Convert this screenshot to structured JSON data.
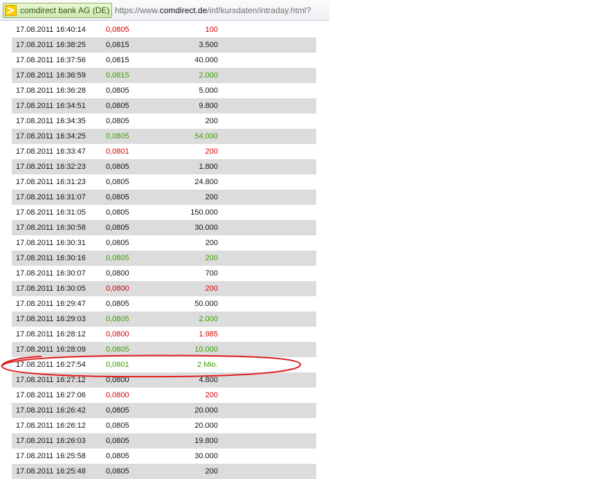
{
  "browser": {
    "site_identity": "comdirect bank AG (DE)",
    "url_prefix": "https://www.",
    "url_host": "comdirect.de",
    "url_path": "/inf/kursdaten/intraday.html?",
    "site_icon": "comdirect-logo-icon"
  },
  "colors": {
    "up": "#3ba000",
    "down": "#d40000",
    "neutral": "#111111",
    "row_alt": "#dcdcdc",
    "annotation": "#e02020"
  },
  "trades": [
    {
      "date": "17.08.2011",
      "time": "16:40:14",
      "price": "0,0805",
      "volume": "100",
      "trend": "down"
    },
    {
      "date": "17.08.2011",
      "time": "16:38:25",
      "price": "0,0815",
      "volume": "3.500",
      "trend": "neutral"
    },
    {
      "date": "17.08.2011",
      "time": "16:37:56",
      "price": "0,0815",
      "volume": "40.000",
      "trend": "neutral"
    },
    {
      "date": "17.08.2011",
      "time": "16:36:59",
      "price": "0,0815",
      "volume": "2.000",
      "trend": "up"
    },
    {
      "date": "17.08.2011",
      "time": "16:36:28",
      "price": "0,0805",
      "volume": "5.000",
      "trend": "neutral"
    },
    {
      "date": "17.08.2011",
      "time": "16:34:51",
      "price": "0,0805",
      "volume": "9.800",
      "trend": "neutral"
    },
    {
      "date": "17.08.2011",
      "time": "16:34:35",
      "price": "0,0805",
      "volume": "200",
      "trend": "neutral"
    },
    {
      "date": "17.08.2011",
      "time": "16:34:25",
      "price": "0,0805",
      "volume": "54.000",
      "trend": "up"
    },
    {
      "date": "17.08.2011",
      "time": "16:33:47",
      "price": "0,0801",
      "volume": "200",
      "trend": "down"
    },
    {
      "date": "17.08.2011",
      "time": "16:32:23",
      "price": "0,0805",
      "volume": "1.800",
      "trend": "neutral"
    },
    {
      "date": "17.08.2011",
      "time": "16:31:23",
      "price": "0,0805",
      "volume": "24.800",
      "trend": "neutral"
    },
    {
      "date": "17.08.2011",
      "time": "16:31:07",
      "price": "0,0805",
      "volume": "200",
      "trend": "neutral"
    },
    {
      "date": "17.08.2011",
      "time": "16:31:05",
      "price": "0,0805",
      "volume": "150.000",
      "trend": "neutral"
    },
    {
      "date": "17.08.2011",
      "time": "16:30:58",
      "price": "0,0805",
      "volume": "30.000",
      "trend": "neutral"
    },
    {
      "date": "17.08.2011",
      "time": "16:30:31",
      "price": "0,0805",
      "volume": "200",
      "trend": "neutral"
    },
    {
      "date": "17.08.2011",
      "time": "16:30:16",
      "price": "0,0805",
      "volume": "200",
      "trend": "up"
    },
    {
      "date": "17.08.2011",
      "time": "16:30:07",
      "price": "0,0800",
      "volume": "700",
      "trend": "neutral"
    },
    {
      "date": "17.08.2011",
      "time": "16:30:05",
      "price": "0,0800",
      "volume": "200",
      "trend": "down"
    },
    {
      "date": "17.08.2011",
      "time": "16:29:47",
      "price": "0,0805",
      "volume": "50.000",
      "trend": "neutral"
    },
    {
      "date": "17.08.2011",
      "time": "16:29:03",
      "price": "0,0805",
      "volume": "2.000",
      "trend": "up"
    },
    {
      "date": "17.08.2011",
      "time": "16:28:12",
      "price": "0,0800",
      "volume": "1.985",
      "trend": "down"
    },
    {
      "date": "17.08.2011",
      "time": "16:28:09",
      "price": "0,0805",
      "volume": "10.000",
      "trend": "up"
    },
    {
      "date": "17.08.2011",
      "time": "16:27:54",
      "price": "0,0801",
      "volume": "2 Mio.",
      "trend": "up",
      "highlighted": true
    },
    {
      "date": "17.08.2011",
      "time": "16:27:12",
      "price": "0,0800",
      "volume": "4.800",
      "trend": "neutral"
    },
    {
      "date": "17.08.2011",
      "time": "16:27:06",
      "price": "0,0800",
      "volume": "200",
      "trend": "down"
    },
    {
      "date": "17.08.2011",
      "time": "16:26:42",
      "price": "0,0805",
      "volume": "20.000",
      "trend": "neutral"
    },
    {
      "date": "17.08.2011",
      "time": "16:26:12",
      "price": "0,0805",
      "volume": "20.000",
      "trend": "neutral"
    },
    {
      "date": "17.08.2011",
      "time": "16:26:03",
      "price": "0,0805",
      "volume": "19.800",
      "trend": "neutral"
    },
    {
      "date": "17.08.2011",
      "time": "16:25:58",
      "price": "0,0805",
      "volume": "30.000",
      "trend": "neutral"
    },
    {
      "date": "17.08.2011",
      "time": "16:25:48",
      "price": "0,0805",
      "volume": "200",
      "trend": "neutral"
    }
  ]
}
